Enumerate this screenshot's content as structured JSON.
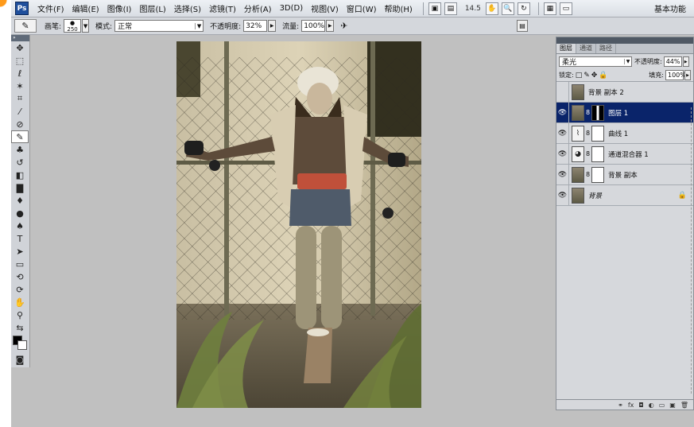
{
  "menubar": {
    "logo": "Ps",
    "items": [
      "文件(F)",
      "编辑(E)",
      "图像(I)",
      "图层(L)",
      "选择(S)",
      "滤镜(T)",
      "分析(A)",
      "3D(D)",
      "视图(V)",
      "窗口(W)",
      "帮助(H)"
    ],
    "zoom": "14.5",
    "workspace": "基本功能"
  },
  "options": {
    "brush_label": "画笔:",
    "brush_size": "250",
    "mode_label": "模式:",
    "mode_value": "正常",
    "opacity_label": "不透明度:",
    "opacity_value": "32%",
    "flow_label": "流量:",
    "flow_value": "100%"
  },
  "layers_panel": {
    "tabs": [
      "图层",
      "通道",
      "路径"
    ],
    "blend_mode": "柔光",
    "opacity_label": "不透明度:",
    "opacity_value": "44%",
    "lock_label": "锁定:",
    "fill_label": "填充:",
    "fill_value": "100%",
    "layers": [
      {
        "name": "背景 副本 2",
        "visible": false,
        "selected": false,
        "type": "image"
      },
      {
        "name": "图层 1",
        "visible": true,
        "selected": true,
        "type": "image-mask"
      },
      {
        "name": "曲线 1",
        "visible": true,
        "selected": false,
        "type": "adjustment"
      },
      {
        "name": "通道混合器 1",
        "visible": true,
        "selected": false,
        "type": "adjustment"
      },
      {
        "name": "背景 副本",
        "visible": true,
        "selected": false,
        "type": "image-mask"
      },
      {
        "name": "背景",
        "visible": true,
        "selected": false,
        "type": "background"
      }
    ]
  },
  "colors": {
    "foreground": "#000000",
    "background": "#ffffff",
    "selection": "#0a246a"
  }
}
